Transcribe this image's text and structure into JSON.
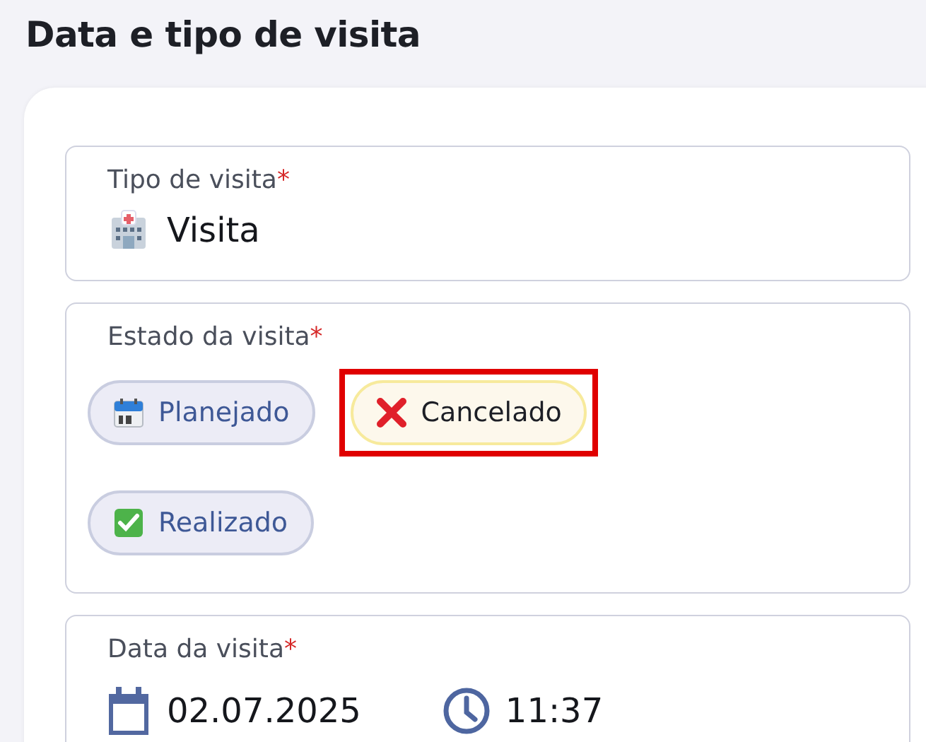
{
  "heading": "Data e tipo de visita",
  "visit_type": {
    "label": "Tipo de visita",
    "required_mark": "*",
    "value": "Visita"
  },
  "visit_status": {
    "label": "Estado da visita",
    "required_mark": "*",
    "options": [
      {
        "kind": "planned",
        "label": "Planejado",
        "selected": false,
        "highlighted": false
      },
      {
        "kind": "cancelled",
        "label": "Cancelado",
        "selected": true,
        "highlighted": true
      },
      {
        "kind": "done",
        "label": "Realizado",
        "selected": false,
        "highlighted": false
      }
    ]
  },
  "visit_date": {
    "label": "Data da visita",
    "required_mark": "*",
    "date": "02.07.2025",
    "time": "11:37"
  }
}
